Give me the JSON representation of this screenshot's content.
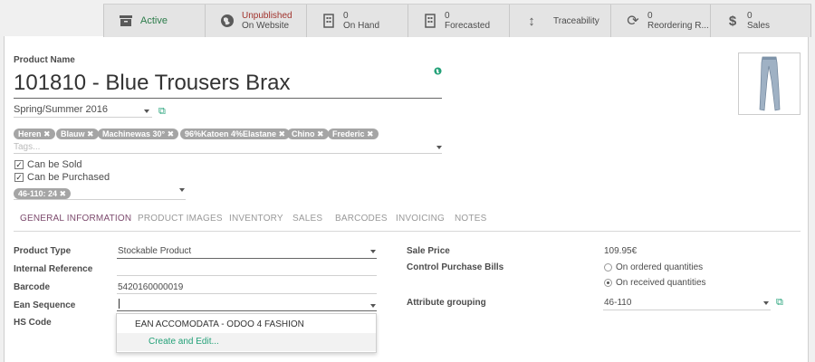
{
  "smart_buttons": [
    {
      "icon": "archive-icon",
      "line1": "",
      "line2": "Active"
    },
    {
      "icon": "globe-icon",
      "line1": "Unpublished",
      "line2": "On Website"
    },
    {
      "icon": "building-icon",
      "line1": "0",
      "line2": "On Hand"
    },
    {
      "icon": "building-icon",
      "line1": "0",
      "line2": "Forecasted"
    },
    {
      "icon": "arrows-vertical-icon",
      "line1": "",
      "line2": "Traceability"
    },
    {
      "icon": "refresh-icon",
      "line1": "0",
      "line2": "Reordering R..."
    },
    {
      "icon": "dollar-icon",
      "line1": "0",
      "line2": "Sales"
    }
  ],
  "product": {
    "name_label": "Product Name",
    "name": "101810 - Blue Trousers Brax",
    "season": "Spring/Summer 2016",
    "tags": [
      "Heren",
      "Blauw",
      "Machinewas 30°",
      "96%Katoen 4%Elastane",
      "Chino",
      "Frederic"
    ],
    "tags_placeholder": "Tags...",
    "can_be_sold": "Can be Sold",
    "can_be_purchased": "Can be Purchased",
    "variant_tag": "46-110: 24"
  },
  "tabs": [
    "GENERAL INFORMATION",
    "PRODUCT IMAGES",
    "INVENTORY",
    "SALES",
    "BARCODES",
    "INVOICING",
    "NOTES"
  ],
  "general": {
    "product_type_label": "Product Type",
    "product_type_value": "Stockable Product",
    "internal_ref_label": "Internal Reference",
    "barcode_label": "Barcode",
    "barcode_value": "5420160000019",
    "ean_label": "Ean Sequence",
    "hs_label": "HS Code",
    "sale_price_label": "Sale Price",
    "sale_price_value": "109.95€",
    "control_label": "Control Purchase Bills",
    "control_opt1": "On ordered quantities",
    "control_opt2": "On received quantities",
    "attr_label": "Attribute grouping",
    "attr_value": "46-110"
  },
  "dropdown": {
    "item1": "EAN ACCOMODATA - ODOO 4 FASHION",
    "item2": "Create and Edit..."
  },
  "colors": {
    "accent": "#7c4a6d",
    "link": "#23a178",
    "unpublished": "#a1332d"
  }
}
